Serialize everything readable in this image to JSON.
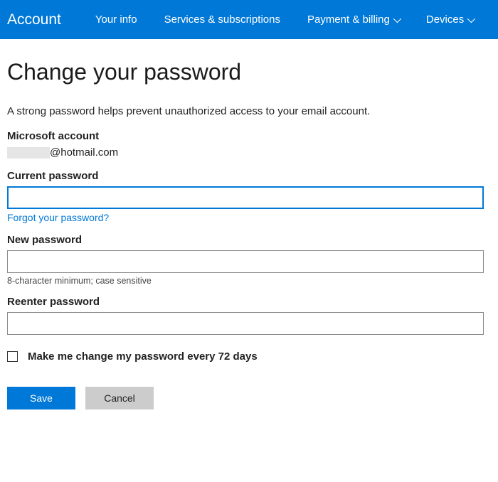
{
  "nav": {
    "brand": "Account",
    "items": [
      {
        "label": "Your info",
        "dropdown": false
      },
      {
        "label": "Services & subscriptions",
        "dropdown": false
      },
      {
        "label": "Payment & billing",
        "dropdown": true
      },
      {
        "label": "Devices",
        "dropdown": true
      }
    ]
  },
  "page": {
    "title": "Change your password",
    "subtitle": "A strong password helps prevent unauthorized access to your email account."
  },
  "account": {
    "label": "Microsoft account",
    "email_domain": "@hotmail.com"
  },
  "fields": {
    "current": {
      "label": "Current password",
      "value": "",
      "forgot_link": "Forgot your password?"
    },
    "new": {
      "label": "New password",
      "value": "",
      "hint": "8-character minimum; case sensitive"
    },
    "reenter": {
      "label": "Reenter password",
      "value": ""
    }
  },
  "checkbox": {
    "label": "Make me change my password every 72 days",
    "checked": false
  },
  "buttons": {
    "save": "Save",
    "cancel": "Cancel"
  }
}
